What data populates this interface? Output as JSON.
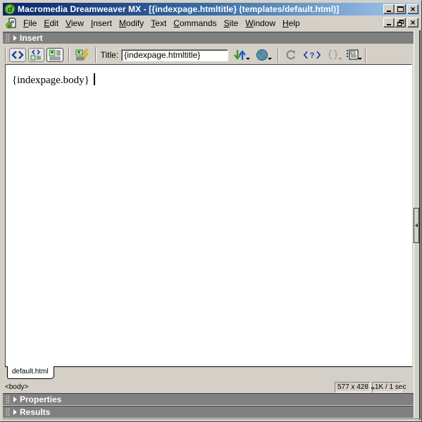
{
  "window": {
    "title": "Macromedia Dreamweaver MX - [{indexpage.htmltitle} (templates/default.html)]",
    "buttons": {
      "minimize": "_",
      "maximize": "□",
      "close": "×"
    },
    "doc_buttons": {
      "minimize": "_",
      "restore": "🗗",
      "close": "×"
    }
  },
  "menubar": {
    "items": [
      {
        "label": "File",
        "mnemonic": "F"
      },
      {
        "label": "Edit",
        "mnemonic": "E"
      },
      {
        "label": "View",
        "mnemonic": "V"
      },
      {
        "label": "Insert",
        "mnemonic": "I"
      },
      {
        "label": "Modify",
        "mnemonic": "M"
      },
      {
        "label": "Text",
        "mnemonic": "T"
      },
      {
        "label": "Commands",
        "mnemonic": "C"
      },
      {
        "label": "Site",
        "mnemonic": "S"
      },
      {
        "label": "Window",
        "mnemonic": "W"
      },
      {
        "label": "Help",
        "mnemonic": "H"
      }
    ]
  },
  "panels": {
    "insert": "Insert",
    "properties": "Properties",
    "results": "Results"
  },
  "toolbar": {
    "views": [
      {
        "name": "code-view",
        "icon": "code-view-icon"
      },
      {
        "name": "split-view",
        "icon": "code-design-view-icon"
      },
      {
        "name": "design-view",
        "icon": "design-view-icon",
        "active": true
      }
    ],
    "live_data_icon": "live-data-view-icon",
    "title_label": "Title:",
    "title_value": "{indexpage.htmltitle}",
    "icons": [
      "file-management-icon",
      "preview-browser-icon",
      "refresh-icon",
      "reference-icon",
      "code-navigation-icon",
      "view-options-icon"
    ]
  },
  "document": {
    "body_text": "{indexpage.body}",
    "tab_label": "default.html"
  },
  "status": {
    "tag_selector": "<body>",
    "window_size": "577 x 428",
    "download": "1K / 1 sec"
  },
  "colors": {
    "title_gradient_start": "#0a246a",
    "title_gradient_end": "#a6caf0",
    "panel_bar": "#808080",
    "chrome": "#d4d0c8"
  }
}
